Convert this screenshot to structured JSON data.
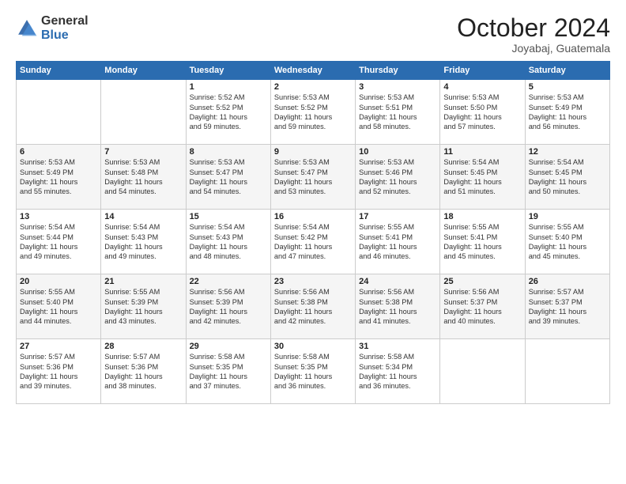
{
  "logo": {
    "general": "General",
    "blue": "Blue"
  },
  "header": {
    "month": "October 2024",
    "location": "Joyabaj, Guatemala"
  },
  "weekdays": [
    "Sunday",
    "Monday",
    "Tuesday",
    "Wednesday",
    "Thursday",
    "Friday",
    "Saturday"
  ],
  "weeks": [
    [
      {
        "day": "",
        "info": ""
      },
      {
        "day": "",
        "info": ""
      },
      {
        "day": "1",
        "info": "Sunrise: 5:52 AM\nSunset: 5:52 PM\nDaylight: 11 hours\nand 59 minutes."
      },
      {
        "day": "2",
        "info": "Sunrise: 5:53 AM\nSunset: 5:52 PM\nDaylight: 11 hours\nand 59 minutes."
      },
      {
        "day": "3",
        "info": "Sunrise: 5:53 AM\nSunset: 5:51 PM\nDaylight: 11 hours\nand 58 minutes."
      },
      {
        "day": "4",
        "info": "Sunrise: 5:53 AM\nSunset: 5:50 PM\nDaylight: 11 hours\nand 57 minutes."
      },
      {
        "day": "5",
        "info": "Sunrise: 5:53 AM\nSunset: 5:49 PM\nDaylight: 11 hours\nand 56 minutes."
      }
    ],
    [
      {
        "day": "6",
        "info": "Sunrise: 5:53 AM\nSunset: 5:49 PM\nDaylight: 11 hours\nand 55 minutes."
      },
      {
        "day": "7",
        "info": "Sunrise: 5:53 AM\nSunset: 5:48 PM\nDaylight: 11 hours\nand 54 minutes."
      },
      {
        "day": "8",
        "info": "Sunrise: 5:53 AM\nSunset: 5:47 PM\nDaylight: 11 hours\nand 54 minutes."
      },
      {
        "day": "9",
        "info": "Sunrise: 5:53 AM\nSunset: 5:47 PM\nDaylight: 11 hours\nand 53 minutes."
      },
      {
        "day": "10",
        "info": "Sunrise: 5:53 AM\nSunset: 5:46 PM\nDaylight: 11 hours\nand 52 minutes."
      },
      {
        "day": "11",
        "info": "Sunrise: 5:54 AM\nSunset: 5:45 PM\nDaylight: 11 hours\nand 51 minutes."
      },
      {
        "day": "12",
        "info": "Sunrise: 5:54 AM\nSunset: 5:45 PM\nDaylight: 11 hours\nand 50 minutes."
      }
    ],
    [
      {
        "day": "13",
        "info": "Sunrise: 5:54 AM\nSunset: 5:44 PM\nDaylight: 11 hours\nand 49 minutes."
      },
      {
        "day": "14",
        "info": "Sunrise: 5:54 AM\nSunset: 5:43 PM\nDaylight: 11 hours\nand 49 minutes."
      },
      {
        "day": "15",
        "info": "Sunrise: 5:54 AM\nSunset: 5:43 PM\nDaylight: 11 hours\nand 48 minutes."
      },
      {
        "day": "16",
        "info": "Sunrise: 5:54 AM\nSunset: 5:42 PM\nDaylight: 11 hours\nand 47 minutes."
      },
      {
        "day": "17",
        "info": "Sunrise: 5:55 AM\nSunset: 5:41 PM\nDaylight: 11 hours\nand 46 minutes."
      },
      {
        "day": "18",
        "info": "Sunrise: 5:55 AM\nSunset: 5:41 PM\nDaylight: 11 hours\nand 45 minutes."
      },
      {
        "day": "19",
        "info": "Sunrise: 5:55 AM\nSunset: 5:40 PM\nDaylight: 11 hours\nand 45 minutes."
      }
    ],
    [
      {
        "day": "20",
        "info": "Sunrise: 5:55 AM\nSunset: 5:40 PM\nDaylight: 11 hours\nand 44 minutes."
      },
      {
        "day": "21",
        "info": "Sunrise: 5:55 AM\nSunset: 5:39 PM\nDaylight: 11 hours\nand 43 minutes."
      },
      {
        "day": "22",
        "info": "Sunrise: 5:56 AM\nSunset: 5:39 PM\nDaylight: 11 hours\nand 42 minutes."
      },
      {
        "day": "23",
        "info": "Sunrise: 5:56 AM\nSunset: 5:38 PM\nDaylight: 11 hours\nand 42 minutes."
      },
      {
        "day": "24",
        "info": "Sunrise: 5:56 AM\nSunset: 5:38 PM\nDaylight: 11 hours\nand 41 minutes."
      },
      {
        "day": "25",
        "info": "Sunrise: 5:56 AM\nSunset: 5:37 PM\nDaylight: 11 hours\nand 40 minutes."
      },
      {
        "day": "26",
        "info": "Sunrise: 5:57 AM\nSunset: 5:37 PM\nDaylight: 11 hours\nand 39 minutes."
      }
    ],
    [
      {
        "day": "27",
        "info": "Sunrise: 5:57 AM\nSunset: 5:36 PM\nDaylight: 11 hours\nand 39 minutes."
      },
      {
        "day": "28",
        "info": "Sunrise: 5:57 AM\nSunset: 5:36 PM\nDaylight: 11 hours\nand 38 minutes."
      },
      {
        "day": "29",
        "info": "Sunrise: 5:58 AM\nSunset: 5:35 PM\nDaylight: 11 hours\nand 37 minutes."
      },
      {
        "day": "30",
        "info": "Sunrise: 5:58 AM\nSunset: 5:35 PM\nDaylight: 11 hours\nand 36 minutes."
      },
      {
        "day": "31",
        "info": "Sunrise: 5:58 AM\nSunset: 5:34 PM\nDaylight: 11 hours\nand 36 minutes."
      },
      {
        "day": "",
        "info": ""
      },
      {
        "day": "",
        "info": ""
      }
    ]
  ]
}
